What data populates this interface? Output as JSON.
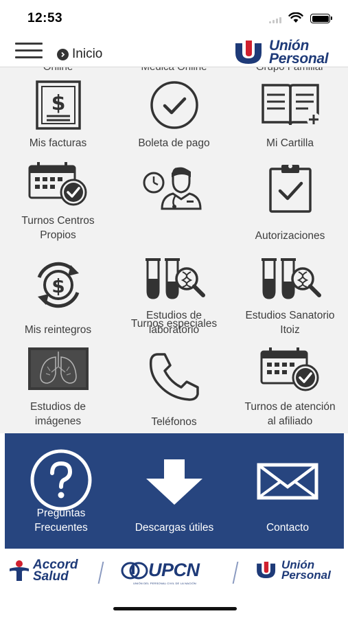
{
  "status_bar": {
    "time": "12:53"
  },
  "header": {
    "back_label": "Inicio",
    "brand_line1": "Unión",
    "brand_line2": "Personal"
  },
  "cutoff_labels": [
    "Online",
    "Médica Online",
    "Grupo Familiar"
  ],
  "grid_items": [
    {
      "label": "Mis facturas",
      "icon": "invoice-dollar-icon"
    },
    {
      "label": "Boleta de pago",
      "icon": "check-circle-icon"
    },
    {
      "label": "Mi Cartilla",
      "icon": "open-book-icon"
    },
    {
      "label": "Turnos Centros\nPropios",
      "icon": "calendar-check-icon"
    },
    {
      "label": "Turnos especiales",
      "icon": "doctor-clock-icon"
    },
    {
      "label": "Autorizaciones",
      "icon": "clipboard-check-icon"
    },
    {
      "label": "Mis reintegros",
      "icon": "dollar-refresh-icon"
    },
    {
      "label": "Estudios de\nlaboratorio",
      "icon": "test-tubes-icon"
    },
    {
      "label": "Estudios Sanatorio\nItoiz",
      "icon": "test-tubes-icon"
    },
    {
      "label": "Estudios de\nimágenes",
      "icon": "xray-lungs-icon"
    },
    {
      "label": "Teléfonos",
      "icon": "phone-icon"
    },
    {
      "label": "Turnos de atención\nal afiliado",
      "icon": "calendar-check-icon"
    }
  ],
  "bottom_actions": [
    {
      "label": "Preguntas\nFrecuentes",
      "icon": "question-circle-icon"
    },
    {
      "label": "Descargas útiles",
      "icon": "download-arrow-icon"
    },
    {
      "label": "Contacto",
      "icon": "envelope-icon"
    }
  ],
  "footer": {
    "accord_line1": "Accord",
    "accord_line2": "Salud",
    "upcn": "UPCN",
    "upcn_tagline": "UNIÓN DEL PERSONAL CIVIL DE LA NACIÓN",
    "up_line1": "Unión",
    "up_line2": "Personal"
  },
  "colors": {
    "brand_blue": "#27457f",
    "brand_red": "#d0202e",
    "icon_dark": "#333333",
    "grid_bg": "#f2f2f2"
  }
}
